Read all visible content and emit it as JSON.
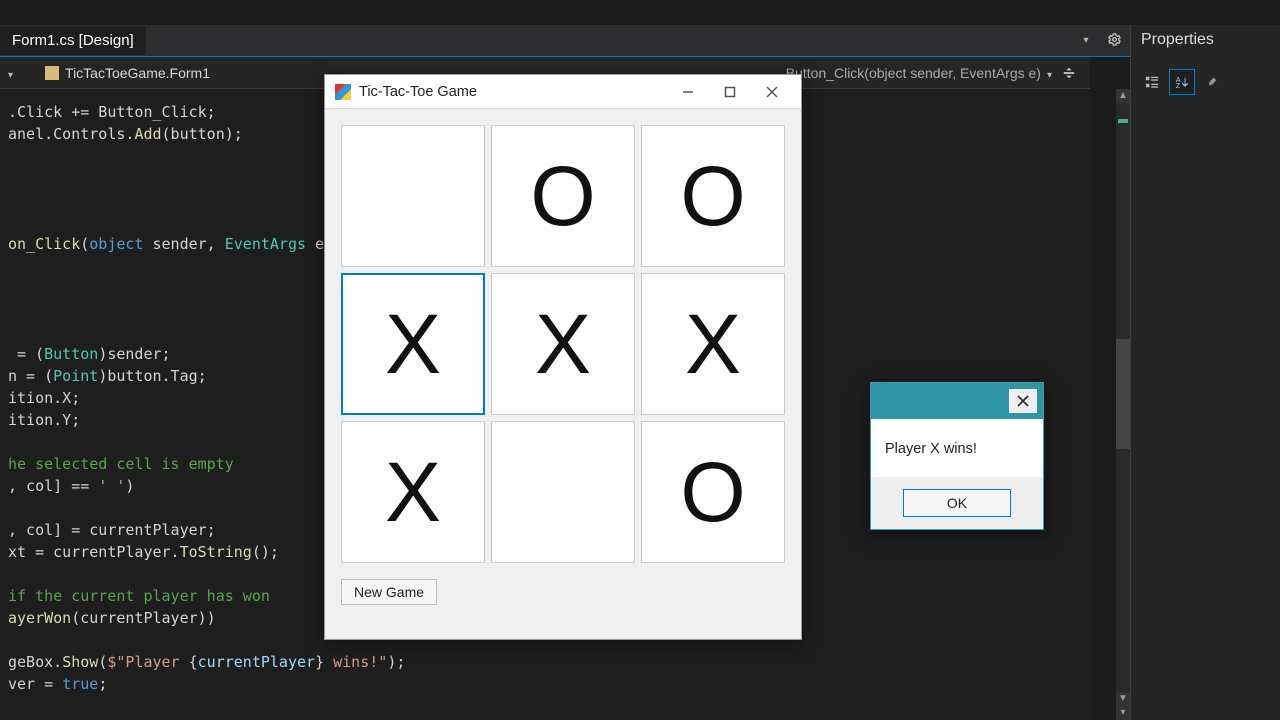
{
  "ide": {
    "active_tab": "Form1.cs [Design]",
    "breadcrumb_left": "TicTacToeGame.Form1",
    "breadcrumb_right": "Button_Click(object sender, EventArgs e)",
    "code_lines": [
      {
        "segs": [
          {
            "t": ".Click += Button_Click;",
            "c": "pl"
          }
        ]
      },
      {
        "segs": [
          {
            "t": "anel.Controls.",
            "c": "pl"
          },
          {
            "t": "Add",
            "c": "mth"
          },
          {
            "t": "(button);",
            "c": "pl"
          }
        ]
      },
      {
        "segs": []
      },
      {
        "segs": []
      },
      {
        "segs": []
      },
      {
        "segs": []
      },
      {
        "segs": [
          {
            "t": "on_Click",
            "c": "mth"
          },
          {
            "t": "(",
            "c": "pl"
          },
          {
            "t": "object",
            "c": "kw"
          },
          {
            "t": " sender, ",
            "c": "pl"
          },
          {
            "t": "EventArgs",
            "c": "cls"
          },
          {
            "t": " e",
            "c": "pl"
          }
        ]
      },
      {
        "segs": []
      },
      {
        "segs": []
      },
      {
        "segs": []
      },
      {
        "segs": []
      },
      {
        "segs": [
          {
            "t": " = (",
            "c": "pl"
          },
          {
            "t": "Button",
            "c": "cls"
          },
          {
            "t": ")sender;",
            "c": "pl"
          }
        ]
      },
      {
        "segs": [
          {
            "t": "n = (",
            "c": "pl"
          },
          {
            "t": "Point",
            "c": "cls"
          },
          {
            "t": ")button.Tag;",
            "c": "pl"
          }
        ]
      },
      {
        "segs": [
          {
            "t": "ition.X;",
            "c": "pl"
          }
        ]
      },
      {
        "segs": [
          {
            "t": "ition.Y;",
            "c": "pl"
          }
        ]
      },
      {
        "segs": []
      },
      {
        "segs": [
          {
            "t": "he selected cell is empty",
            "c": "cmt"
          }
        ]
      },
      {
        "segs": [
          {
            "t": ", col] == ",
            "c": "pl"
          },
          {
            "t": "' '",
            "c": "str"
          },
          {
            "t": ")",
            "c": "pl"
          }
        ]
      },
      {
        "segs": []
      },
      {
        "segs": [
          {
            "t": ", col] = currentPlayer;",
            "c": "pl"
          }
        ]
      },
      {
        "segs": [
          {
            "t": "xt = currentPlayer.",
            "c": "pl"
          },
          {
            "t": "ToString",
            "c": "mth"
          },
          {
            "t": "();",
            "c": "pl"
          }
        ]
      },
      {
        "segs": []
      },
      {
        "segs": [
          {
            "t": "if the current player has won",
            "c": "cmt"
          }
        ]
      },
      {
        "segs": [
          {
            "t": "ayerWon",
            "c": "mth"
          },
          {
            "t": "(currentPlayer))",
            "c": "pl"
          }
        ]
      },
      {
        "segs": []
      },
      {
        "segs": [
          {
            "t": "geBox.",
            "c": "pl"
          },
          {
            "t": "Show",
            "c": "mth"
          },
          {
            "t": "(",
            "c": "pl"
          },
          {
            "t": "$\"Player ",
            "c": "str"
          },
          {
            "t": "{",
            "c": "pl"
          },
          {
            "t": "currentPlayer",
            "c": "id"
          },
          {
            "t": "}",
            "c": "pl"
          },
          {
            "t": " wins!\"",
            "c": "str"
          },
          {
            "t": ");",
            "c": "pl"
          }
        ]
      },
      {
        "segs": [
          {
            "t": "ver = ",
            "c": "pl"
          },
          {
            "t": "true",
            "c": "kw"
          },
          {
            "t": ";",
            "c": "pl"
          }
        ]
      }
    ]
  },
  "properties_panel": {
    "title": "Properties"
  },
  "game": {
    "window_title": "Tic-Tac-Toe Game",
    "cells": [
      "",
      "O",
      "O",
      "X",
      "X",
      "X",
      "X",
      "",
      "O"
    ],
    "highlighted_index": 3,
    "new_game_label": "New Game"
  },
  "msgbox": {
    "message": "Player X wins!",
    "ok_label": "OK"
  }
}
